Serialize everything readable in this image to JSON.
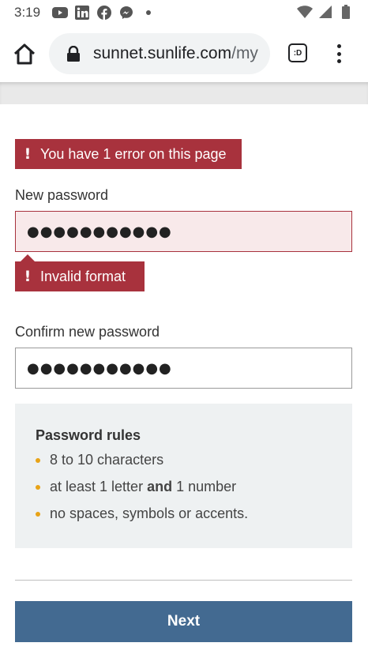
{
  "status_bar": {
    "time": "3:19",
    "app_icons": [
      "youtube-icon",
      "linkedin-icon",
      "facebook-icon",
      "messenger-icon",
      "dot-icon"
    ],
    "system_icons": [
      "wifi-icon",
      "signal-icon",
      "battery-icon"
    ]
  },
  "browser": {
    "url_main": "sunnet.sunlife.com",
    "url_path": "/my",
    "tab_switcher_label": ":D"
  },
  "form": {
    "error_banner": "You have 1 error on this page",
    "new_password_label": "New password",
    "new_password_value": "●●●●●●●●●●●",
    "inline_error": "Invalid format",
    "confirm_password_label": "Confirm new password",
    "confirm_password_value": "●●●●●●●●●●●",
    "error_mark": "!"
  },
  "rules": {
    "title": "Password rules",
    "items": [
      "8 to 10 characters",
      "at least 1 letter",
      "no spaces, symbols or accents."
    ],
    "item2_bold": "and",
    "item2_suffix": "1 number"
  },
  "actions": {
    "next_label": "Next"
  },
  "colors": {
    "error": "#a8323d",
    "primary_button": "#436a91",
    "bullet": "#e8a317",
    "rules_background": "#eef1f2"
  }
}
